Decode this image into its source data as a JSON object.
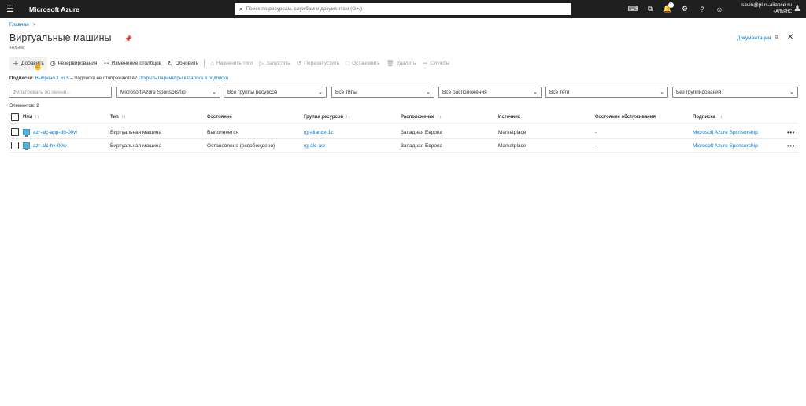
{
  "topbar": {
    "brand": "Microsoft Azure",
    "search_placeholder": "Поиск по ресурсам, службам и документам (G+/)",
    "notification_count": "1",
    "email": "savin@plus-aliance.ru",
    "org": "+АЛЬЯНС"
  },
  "breadcrumb": {
    "home": "Главная",
    "separator": ">"
  },
  "page": {
    "title": "Виртуальные машины",
    "subtitle": "+Альянс",
    "docs_label": "Документация"
  },
  "toolbar": {
    "add": "Добавить",
    "reservations": "Резервирования",
    "edit_columns": "Изменение столбцов",
    "refresh": "Обновить",
    "assign_tags": "Назначить теги",
    "start": "Запустить",
    "restart": "Перезапустить",
    "stop": "Остановить",
    "delete": "Удалить",
    "services": "Службы"
  },
  "subscriptions": {
    "label": "Подписки:",
    "selected": "Выбрано 1 из 8",
    "question": " – Подписки не отображаются?",
    "link": "Открыть параметры каталога и подписки"
  },
  "filters": {
    "name_placeholder": "Фильтровать по имени...",
    "subscription": "Microsoft Azure Sponsorship",
    "resource_groups": "Все группы ресурсов",
    "types": "Все типы",
    "locations": "Все расположения",
    "tags": "Все теги",
    "grouping": "Без группирования"
  },
  "count_label": "Элементов: 2",
  "table": {
    "columns": {
      "name": "Имя",
      "type": "Тип",
      "status": "Состояние",
      "resource_group": "Группа ресурсов",
      "location": "Расположение",
      "source": "Источник",
      "maintenance": "Состояние обслуживания",
      "subscription": "Подписка",
      "sort_glyph": "↑↓"
    },
    "rows": [
      {
        "name": "azr-alc-app-db-00w",
        "type": "Виртуальная машина",
        "status": "Выполняется",
        "resource_group": "rg-aliance-1c",
        "location": "Западная Европа",
        "source": "Marketplace",
        "maintenance": "-",
        "subscription": "Microsoft Azure Sponsorship"
      },
      {
        "name": "azr-alc-hv-00w",
        "type": "Виртуальная машина",
        "status": "Остановлено (освобождено)",
        "resource_group": "rg-alc-asr",
        "location": "Западная Европа",
        "source": "Marketplace",
        "maintenance": "-",
        "subscription": "Microsoft Azure Sponsorship"
      }
    ]
  },
  "colors": {
    "topbar": "#1f1f1f",
    "link": "#0078d4",
    "text": "#323130",
    "disabled": "#a19f9d"
  }
}
